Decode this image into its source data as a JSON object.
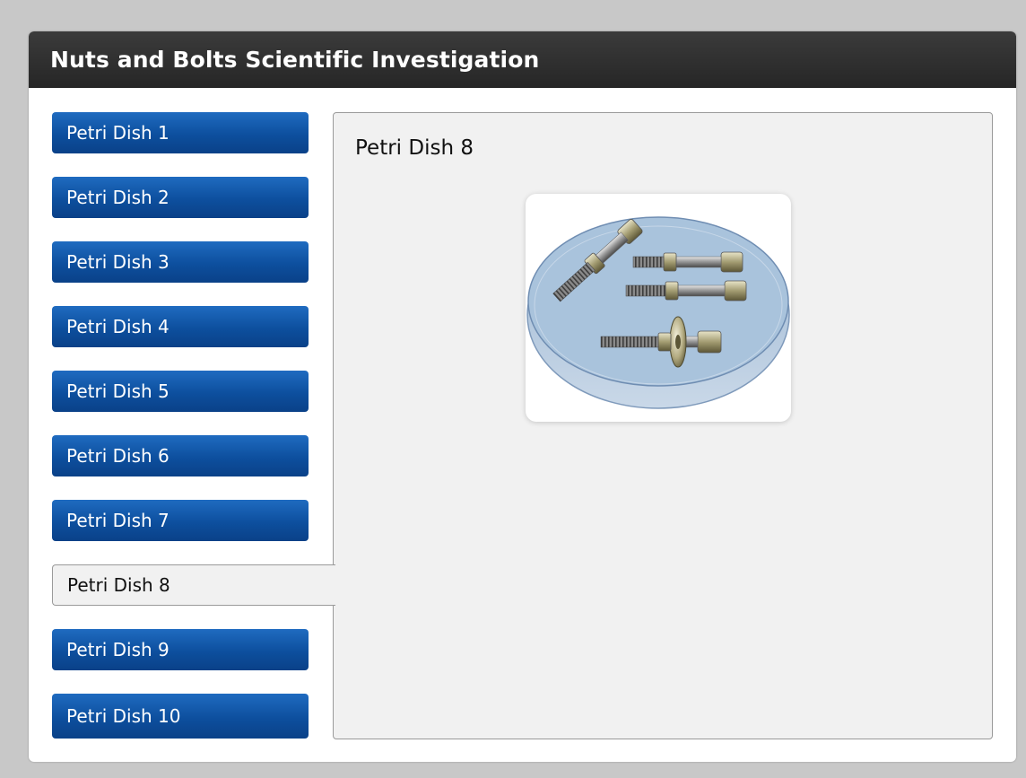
{
  "window": {
    "title": "Nuts and Bolts Scientific Investigation"
  },
  "tabs": [
    {
      "label": "Petri Dish 1",
      "selected": false
    },
    {
      "label": "Petri Dish 2",
      "selected": false
    },
    {
      "label": "Petri Dish 3",
      "selected": false
    },
    {
      "label": "Petri Dish 4",
      "selected": false
    },
    {
      "label": "Petri Dish 5",
      "selected": false
    },
    {
      "label": "Petri Dish 6",
      "selected": false
    },
    {
      "label": "Petri Dish 7",
      "selected": false
    },
    {
      "label": "Petri Dish 8",
      "selected": true
    },
    {
      "label": "Petri Dish 9",
      "selected": false
    },
    {
      "label": "Petri Dish 10",
      "selected": false
    }
  ],
  "panel": {
    "title": "Petri Dish 8",
    "image": "petri-dish-with-bolts-illustration"
  },
  "colors": {
    "tab_blue": "#0d4f9e",
    "title_bar": "#2e2e2e",
    "panel_bg": "#f1f1f1",
    "dish_fill": "#a9c3dc"
  }
}
